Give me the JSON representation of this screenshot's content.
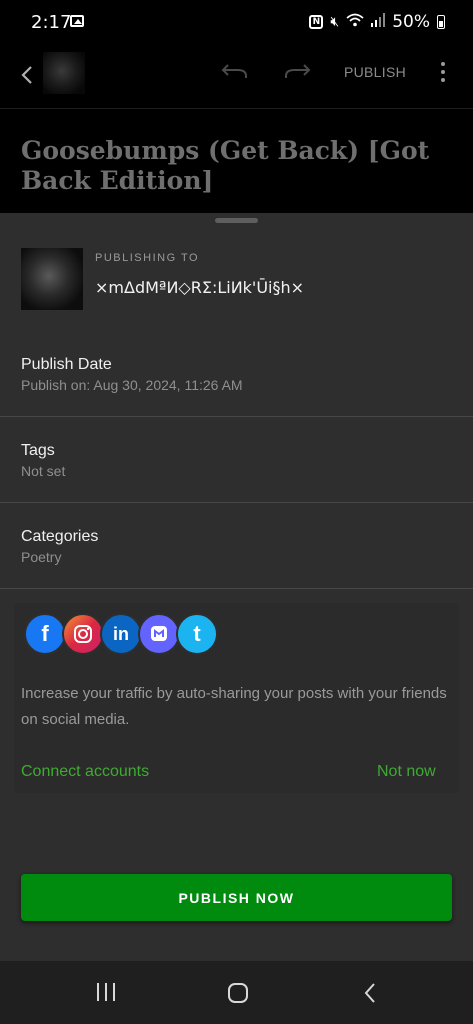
{
  "status_bar": {
    "time": "2:17",
    "battery": "50%",
    "icons": [
      "gallery-icon",
      "nfc-icon",
      "mute-icon",
      "wifi-icon",
      "signal-icon",
      "battery-icon"
    ]
  },
  "top_bar": {
    "publish_label": "PUBLISH",
    "icons": [
      "back-chevron-icon",
      "undo-icon",
      "redo-icon",
      "more-vertical-icon"
    ]
  },
  "post": {
    "title": "Goosebumps (Get Back) [Got Back Edition]"
  },
  "sheet": {
    "publishing_to_label": "PUBLISHING TO",
    "site_name": "×mΔdMªИ◇RΣ:LiИk'Ūi§h×",
    "publish_date": {
      "title": "Publish Date",
      "value": "Publish on: Aug 30, 2024, 11:26 AM"
    },
    "tags": {
      "title": "Tags",
      "value": "Not set"
    },
    "categories": {
      "title": "Categories",
      "value": "Poetry"
    },
    "social": {
      "networks": [
        {
          "name": "facebook-icon",
          "color": "#1877f2"
        },
        {
          "name": "instagram-icon",
          "color": "#dc2743"
        },
        {
          "name": "linkedin-icon",
          "color": "#0a66c2"
        },
        {
          "name": "mastodon-icon",
          "color": "#6364ff"
        },
        {
          "name": "tumblr-icon",
          "color": "#1cb4f0"
        }
      ],
      "description": "Increase your traffic by auto-sharing your posts with your friends on social media.",
      "connect_label": "Connect accounts",
      "not_now_label": "Not now"
    },
    "publish_now_label": "PUBLISH NOW"
  },
  "colors": {
    "accent_green": "#3faa32",
    "button_green": "#008a0e",
    "sheet_background": "#2e2e2e"
  },
  "nav_bar": {
    "icons": [
      "recents-icon",
      "home-icon",
      "back-icon"
    ]
  }
}
